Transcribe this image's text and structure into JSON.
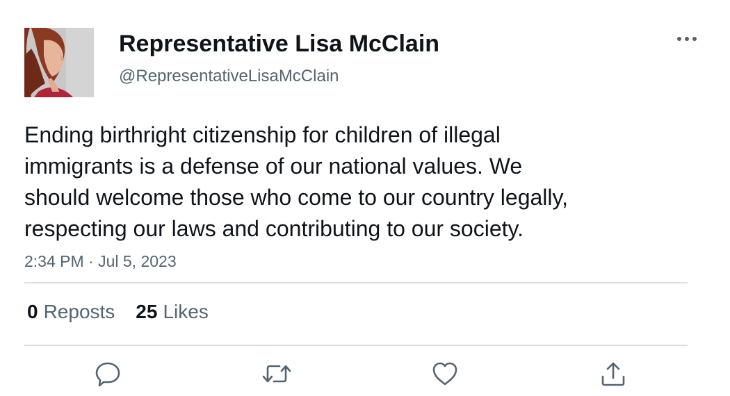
{
  "author": {
    "display_name": "Representative Lisa McClain",
    "handle": "@RepresentativeLisaMcClain"
  },
  "tweet": {
    "text_lines": [
      "Ending birthright citizenship for children of illegal",
      "immigrants is a defense of our national values. We",
      "should welcome those who come to our country legally,",
      "respecting our laws and contributing to our society."
    ],
    "timestamp": "2:34 PM · Jul 5, 2023"
  },
  "stats": {
    "reposts_count": "0",
    "reposts_label": "Reposts",
    "likes_count": "25",
    "likes_label": "Likes"
  },
  "icons": {
    "more": "more-horizontal-icon",
    "reply": "reply-bubble-icon",
    "repost": "repost-arrows-icon",
    "like": "heart-icon",
    "share": "share-upload-icon"
  },
  "colors": {
    "text_primary": "#0f1419",
    "text_secondary": "#536471",
    "icon_gray": "#536471",
    "divider": "#dcdfe2"
  }
}
